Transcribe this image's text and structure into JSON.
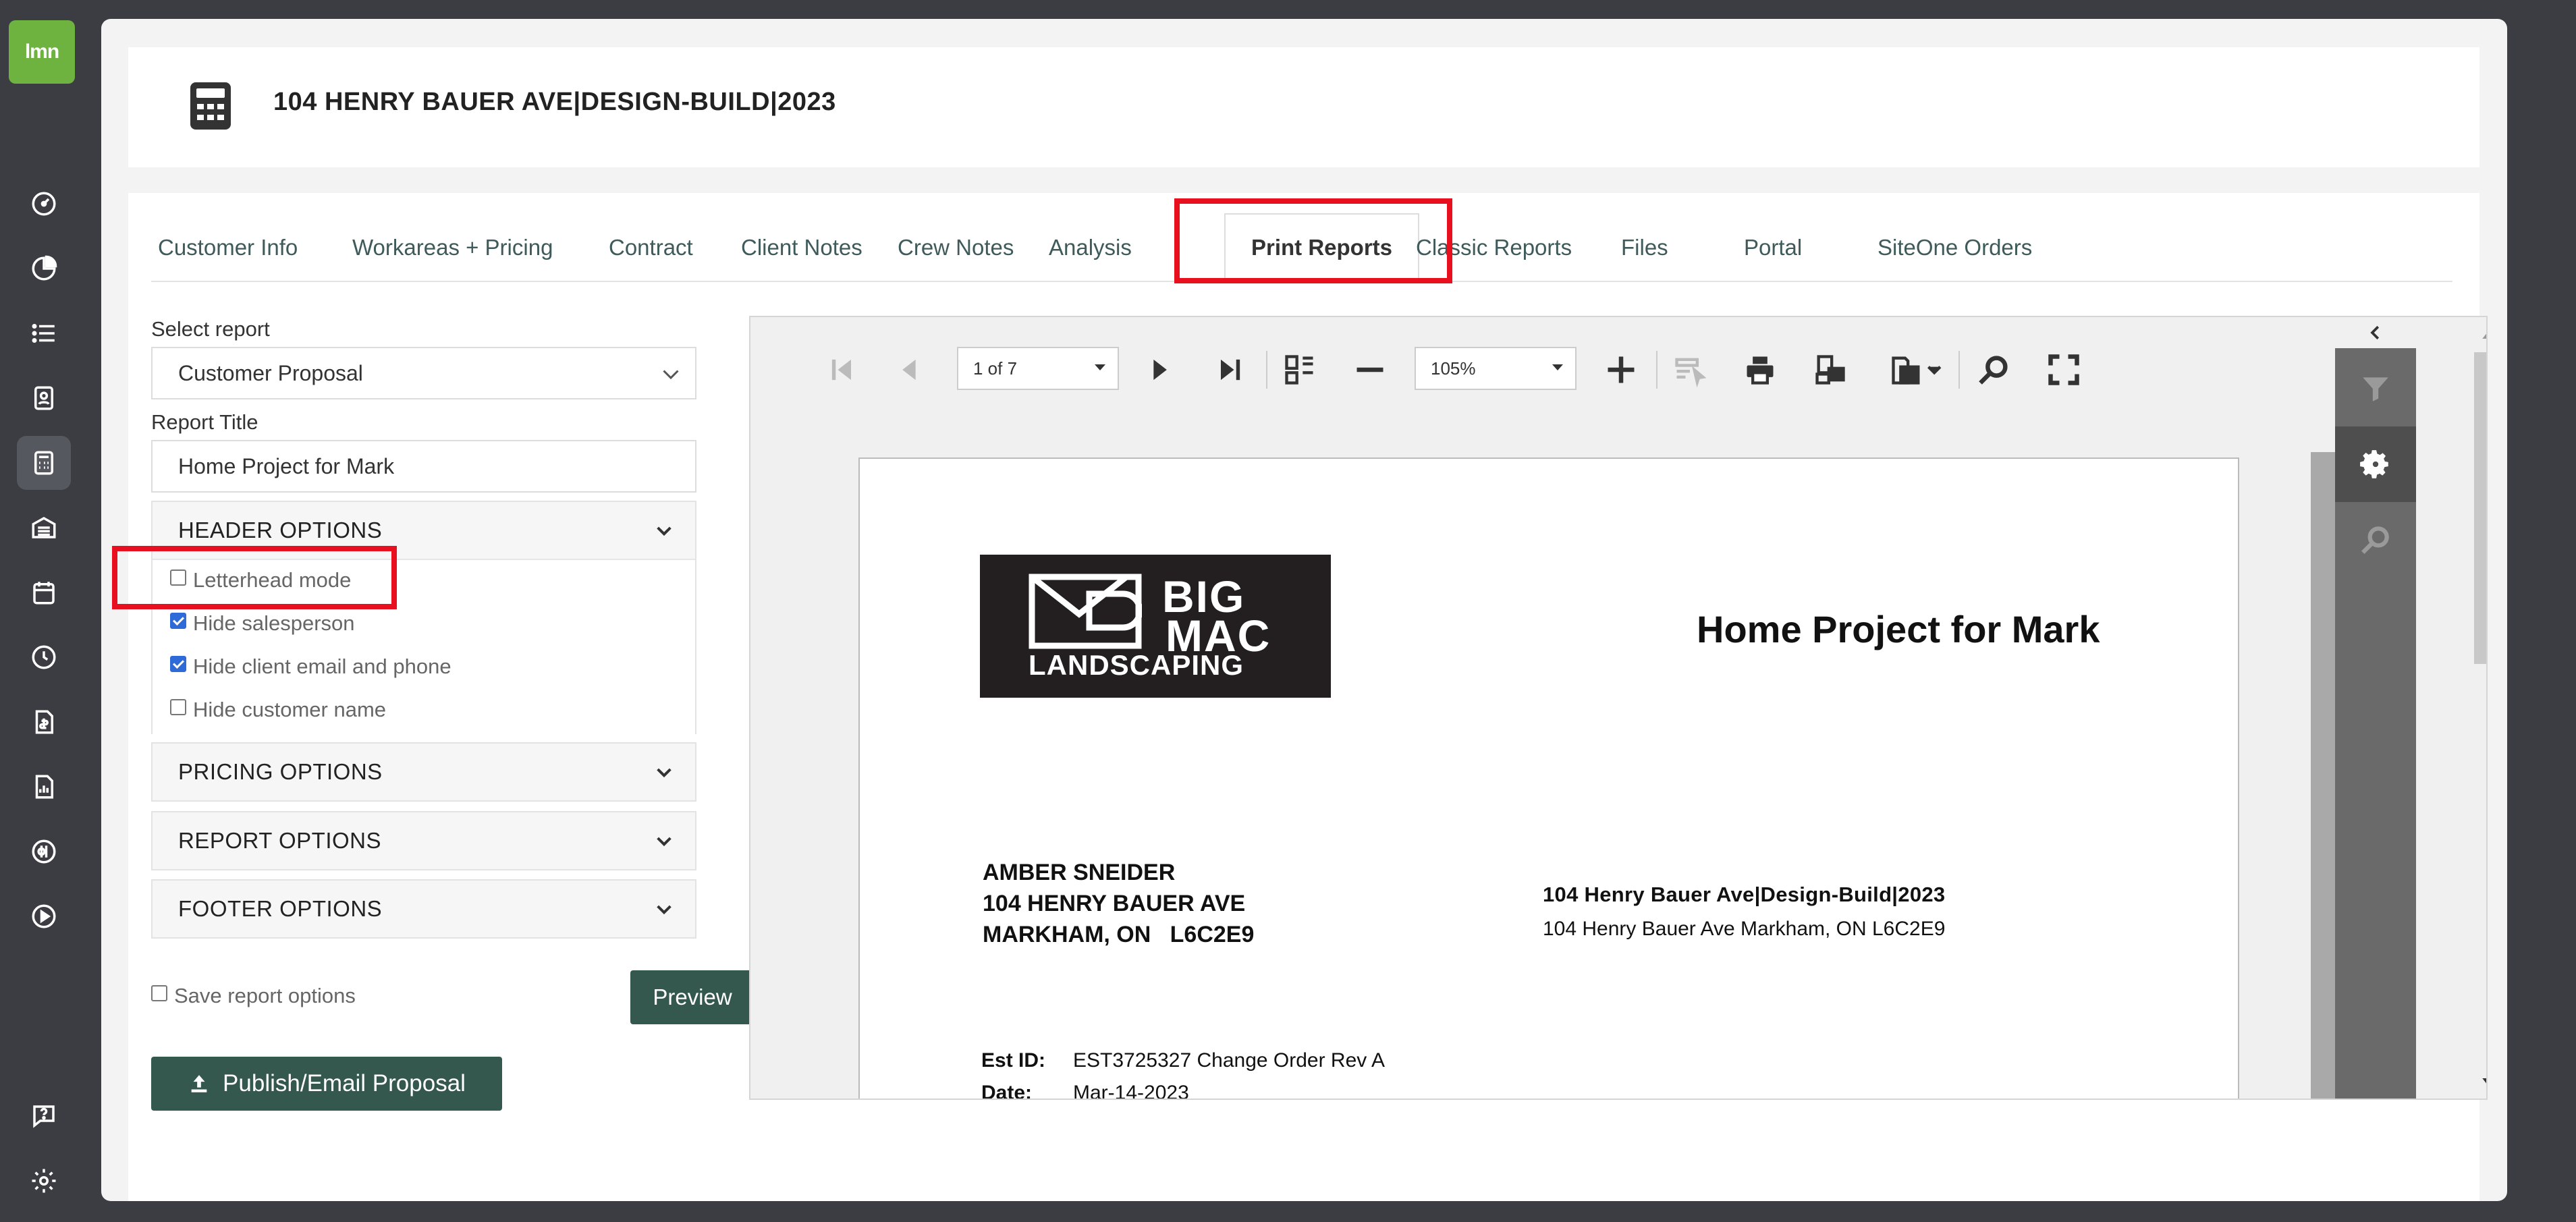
{
  "app": {
    "logo_text": "lmn"
  },
  "rail": {
    "icons": [
      "dashboard-icon",
      "chart-pie-icon",
      "list-icon",
      "contact-card-icon",
      "calculator-icon",
      "warehouse-icon",
      "calendar-icon",
      "clock-icon",
      "invoice-icon",
      "report-icon",
      "quickbooks-icon",
      "play-icon",
      "help-icon",
      "settings-icon"
    ],
    "active": "calculator-icon"
  },
  "header": {
    "title": "104 HENRY BAUER AVE|DESIGN-BUILD|2023"
  },
  "tabs": [
    {
      "label": "Customer Info"
    },
    {
      "label": "Workareas + Pricing"
    },
    {
      "label": "Contract"
    },
    {
      "label": "Client Notes"
    },
    {
      "label": "Crew Notes"
    },
    {
      "label": "Analysis"
    },
    {
      "label": "Print Reports",
      "active": true
    },
    {
      "label": "Classic Reports"
    },
    {
      "label": "Files"
    },
    {
      "label": "Portal"
    },
    {
      "label": "SiteOne Orders"
    }
  ],
  "options": {
    "select_report_label": "Select report",
    "select_report_value": "Customer Proposal",
    "report_title_label": "Report Title",
    "report_title_value": "Home Project for Mark",
    "header_options": {
      "title": "HEADER OPTIONS",
      "items": [
        {
          "label": "Letterhead mode",
          "checked": false
        },
        {
          "label": "Hide salesperson",
          "checked": true
        },
        {
          "label": "Hide client email and phone",
          "checked": true
        },
        {
          "label": "Hide customer name",
          "checked": false
        }
      ]
    },
    "pricing_options": "PRICING OPTIONS",
    "report_options": "REPORT OPTIONS",
    "footer_options": "FOOTER OPTIONS",
    "save_report_options": "Save report options",
    "save_checked": false,
    "preview_button": "Preview",
    "publish_button": "Publish/Email Proposal"
  },
  "viewer": {
    "page_indicator": "1 of 7",
    "zoom": "105%"
  },
  "document": {
    "brand": {
      "line1": "BIG",
      "line2": "MAC",
      "line3": "LANDSCAPING"
    },
    "title": "Home Project for Mark",
    "customer_lines": [
      "AMBER SNEIDER",
      "104 HENRY BAUER AVE",
      "MARKHAM, ON   L6C2E9"
    ],
    "project_title": "104 Henry Bauer Ave|Design-Build|2023",
    "project_address": "104 Henry Bauer Ave Markham, ON L6C2E9",
    "est_id_label": "Est ID:",
    "est_id_value": "EST3725327 Change Order Rev A",
    "date_label": "Date:",
    "date_value": "Mar-14-2023"
  },
  "colors": {
    "highlight": "#e8101e",
    "brand_green": "#6eb33f",
    "button_green": "#35584e",
    "rail_bg": "#3b3d42"
  }
}
